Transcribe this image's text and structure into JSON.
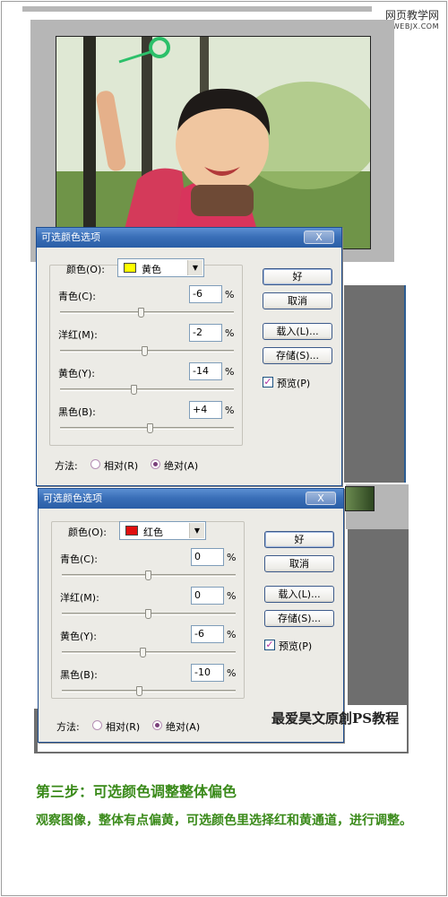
{
  "watermark": {
    "title": "网页教学网",
    "url": "WWW.WEBJX.COM"
  },
  "brand_caption": "最爱昊文原創PS教程",
  "step": {
    "title": "第三步：可选颜色调整整体偏色",
    "description": "观察图像，整体有点偏黄，可选颜色里选择红和黄通道，进行调整。"
  },
  "dialogs": [
    {
      "title": "可选颜色选项",
      "close_label": "X",
      "colors_label": "颜色(O):",
      "colors_value": "黄色",
      "colors_swatch": "#ffff00",
      "sliders": [
        {
          "label": "青色(C):",
          "value": "-6",
          "unit": "%",
          "level": 0.47
        },
        {
          "label": "洋红(M):",
          "value": "-2",
          "unit": "%",
          "level": 0.49
        },
        {
          "label": "黄色(Y):",
          "value": "-14",
          "unit": "%",
          "level": 0.43
        },
        {
          "label": "黑色(B):",
          "value": "+4",
          "unit": "%",
          "level": 0.52
        }
      ],
      "buttons": {
        "ok": "好",
        "cancel": "取消",
        "load": "载入(L)...",
        "save": "存储(S)..."
      },
      "preview_label": "预览(P)",
      "preview_checked": true,
      "method_label": "方法:",
      "method_relative": "相对(R)",
      "method_absolute": "绝对(A)",
      "method_selected": "absolute"
    },
    {
      "title": "可选颜色选项",
      "close_label": "X",
      "colors_label": "颜色(O):",
      "colors_value": "红色",
      "colors_swatch": "#e01010",
      "sliders": [
        {
          "label": "青色(C):",
          "value": "0",
          "unit": "%",
          "level": 0.5
        },
        {
          "label": "洋红(M):",
          "value": "0",
          "unit": "%",
          "level": 0.5
        },
        {
          "label": "黄色(Y):",
          "value": "-6",
          "unit": "%",
          "level": 0.47
        },
        {
          "label": "黑色(B):",
          "value": "-10",
          "unit": "%",
          "level": 0.45
        }
      ],
      "buttons": {
        "ok": "好",
        "cancel": "取消",
        "load": "载入(L)...",
        "save": "存储(S)..."
      },
      "preview_label": "预览(P)",
      "preview_checked": true,
      "method_label": "方法:",
      "method_relative": "相对(R)",
      "method_absolute": "绝对(A)",
      "method_selected": "absolute"
    }
  ]
}
